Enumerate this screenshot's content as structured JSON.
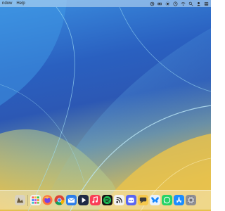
{
  "menubar": {
    "items": [
      "ndow",
      "Help"
    ]
  },
  "status_icons": [
    "recording-icon",
    "battery-icon",
    "brightness-icon",
    "clock-icon",
    "wifi-icon",
    "search-icon",
    "user-icon",
    "control-center-icon"
  ],
  "dock": {
    "apps": [
      "preview-icon",
      "launchpad-icon",
      "firefox-icon",
      "chrome-icon",
      "mail-icon",
      "infuse-icon",
      "music-icon",
      "spotify-icon",
      "rss-reader-icon",
      "discord-icon",
      "messages-icon",
      "bluesky-icon",
      "whatsapp-icon",
      "app-store-icon",
      "system-settings-icon"
    ]
  },
  "colors": {
    "wallpaper_top": "#2a66c4",
    "wallpaper_bottom": "#e7bf4a",
    "accent_cyan": "#7ad7f0"
  }
}
